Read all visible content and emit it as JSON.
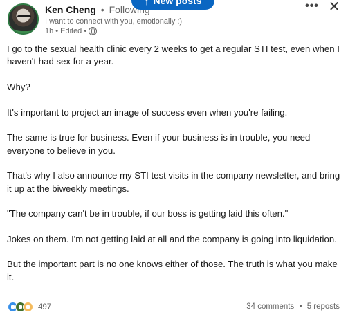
{
  "header": {
    "author_name": "Ken Cheng",
    "separator": "•",
    "follow_status": "Following",
    "tagline": "I want to connect with you, emotionally :)",
    "time": "1h",
    "edited": "Edited",
    "visibility_icon": "globe-icon"
  },
  "new_posts": {
    "label": "New posts",
    "icon": "arrow-up-icon"
  },
  "controls": {
    "more_icon": "more-horizontal-icon",
    "close_icon": "close-icon"
  },
  "post": {
    "paragraphs": [
      "I go to the sexual health clinic every 2 weeks to get a regular STI test, even when I haven't had sex for a year.",
      "Why?",
      "It's important to project an image of success even when you're failing.",
      "The same is true for business. Even if your business is in trouble, you need everyone to believe in you.",
      "That's why I also announce my STI test visits in the company newsletter, and bring it up at the biweekly meetings.",
      "\"The company can't be in trouble, if our boss is getting laid this often.\"",
      "Jokes on them. I'm not getting laid at all and the company is going into liquidation.",
      "But the important part is no one knows either of those. The truth is what you make it."
    ]
  },
  "footer": {
    "reaction_icons": [
      "like-icon",
      "celebrate-icon",
      "insightful-icon"
    ],
    "reaction_colors": [
      "#378fe9",
      "#44712e",
      "#f5bb5c"
    ],
    "reaction_count": "497",
    "comments": "34 comments",
    "separator": "•",
    "reposts": "5 reposts"
  },
  "colors": {
    "accent": "#0a66c2",
    "text_primary": "#191919",
    "text_secondary": "#666666"
  }
}
